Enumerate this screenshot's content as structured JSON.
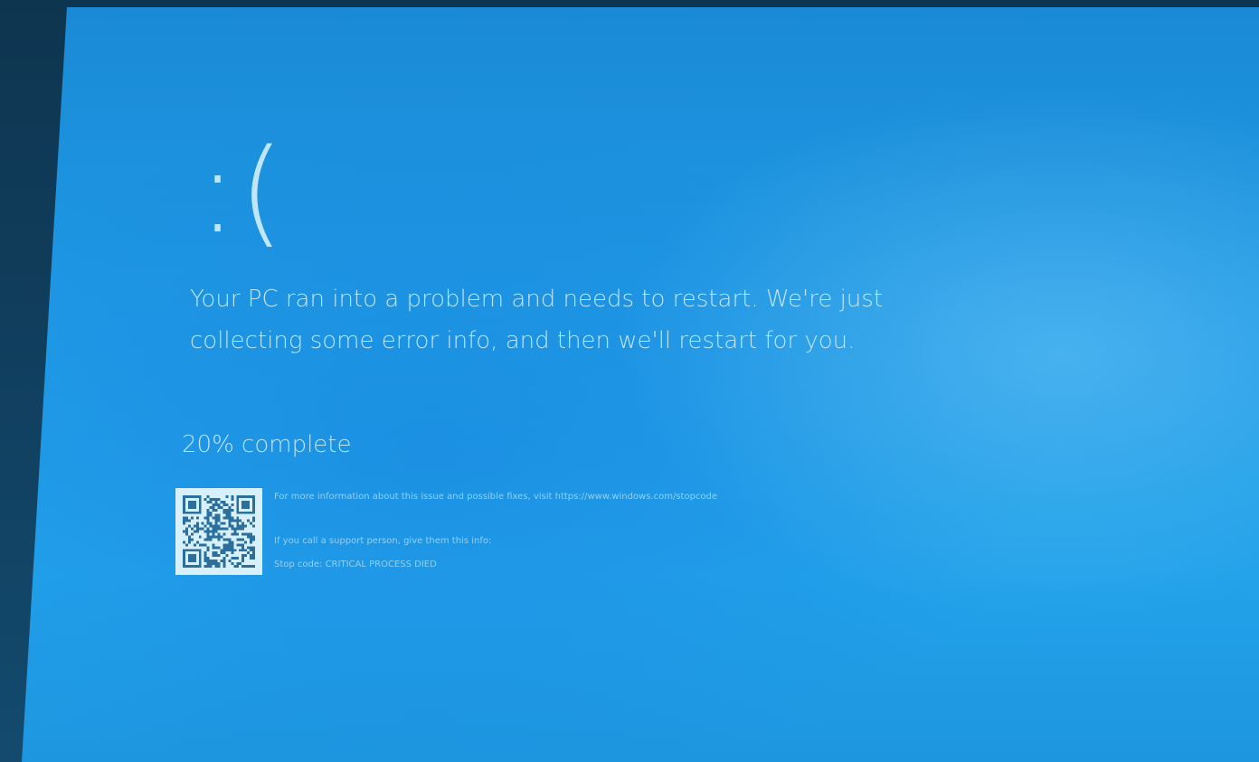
{
  "screen": {
    "background_color": "#1f99e4",
    "text_color": "#bde4fa"
  },
  "face": {
    "emoticon": ":("
  },
  "message": {
    "text": "Your PC ran into a problem and needs to restart. We're just collecting some error info, and then we'll restart for you."
  },
  "progress": {
    "text": "20% complete",
    "percent": 20
  },
  "qr_code": {
    "icon": "qr-code-icon"
  },
  "info": {
    "more_info": "For more information about this issue and possible fixes, visit https://www.windows.com/stopcode",
    "support_note": "If you call a support person, give them this info:",
    "stop_code": "Stop code: CRITICAL PROCESS DIED"
  }
}
